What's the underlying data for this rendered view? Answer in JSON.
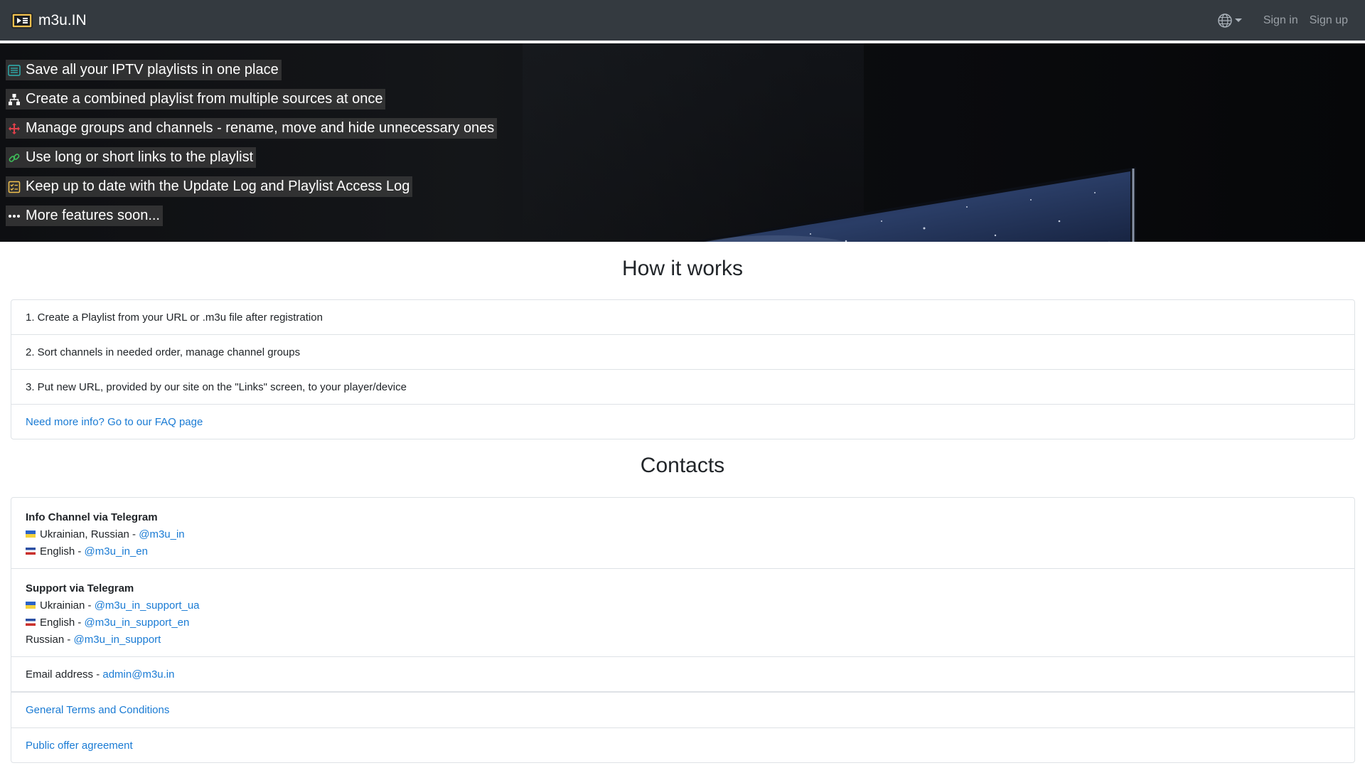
{
  "navbar": {
    "brand": "m3u.IN",
    "language_icon": "globe-icon",
    "sign_in": "Sign in",
    "sign_up": "Sign up",
    "bg_color": "#343a40"
  },
  "hero": {
    "features": [
      {
        "icon": "playlist-icon",
        "text": "Save all your IPTV playlists in one place"
      },
      {
        "icon": "sitemap-icon",
        "text": "Create a combined playlist from multiple sources at once"
      },
      {
        "icon": "move-arrows-icon",
        "text": "Manage groups and channels - rename, move and hide unnecessary ones"
      },
      {
        "icon": "link-icon",
        "text": "Use long or short links to the playlist"
      },
      {
        "icon": "checklist-icon",
        "text": "Keep up to date with the Update Log and Playlist Access Log"
      },
      {
        "icon": "ellipsis-icon",
        "text": "More features soon..."
      }
    ]
  },
  "how_it_works": {
    "title": "How it works",
    "steps": [
      "1. Create a Playlist from your URL or .m3u file after registration",
      "2. Sort channels in needed order, manage channel groups",
      "3. Put new URL, provided by our site on the \"Links\" screen, to your player/device"
    ],
    "faq_link": "Need more info? Go to our FAQ page"
  },
  "contacts": {
    "title": "Contacts",
    "info_channel": {
      "heading": "Info Channel via Telegram",
      "lines": [
        {
          "label": "Ukrainian, Russian - ",
          "link": "@m3u_in"
        },
        {
          "label": "English - ",
          "link": "@m3u_in_en"
        }
      ]
    },
    "support": {
      "heading": "Support via Telegram",
      "lines": [
        {
          "label": "Ukrainian - ",
          "link": "@m3u_in_support_ua"
        },
        {
          "label": "English - ",
          "link": "@m3u_in_support_en"
        },
        {
          "label": "Russian - ",
          "link": "@m3u_in_support"
        }
      ]
    },
    "email": {
      "label": "Email address - ",
      "link": "admin@m3u.in"
    },
    "terms": "General Terms and Conditions",
    "offer": "Public offer agreement"
  },
  "colors": {
    "link": "#1a7bd4",
    "border": "#dee2e6",
    "text": "#212529"
  }
}
